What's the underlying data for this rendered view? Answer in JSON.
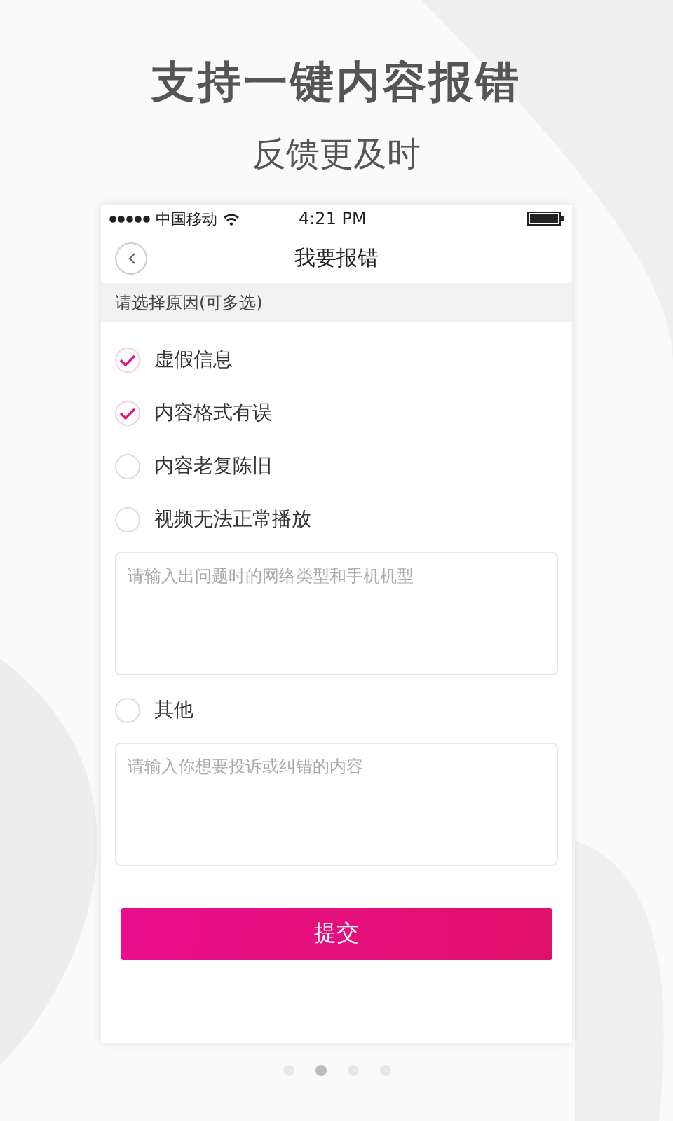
{
  "headline": "支持一键内容报错",
  "subheadline": "反馈更及时",
  "status_bar": {
    "carrier": "中国移动",
    "time": "4:21 PM"
  },
  "nav": {
    "title": "我要报错"
  },
  "section_header": "请选择原因(可多选)",
  "items": [
    {
      "kind": "checkbox",
      "label": "虚假信息",
      "checked": true
    },
    {
      "kind": "checkbox",
      "label": "内容格式有误",
      "checked": true
    },
    {
      "kind": "checkbox",
      "label": "内容老复陈旧",
      "checked": false
    },
    {
      "kind": "checkbox",
      "label": "视频无法正常播放",
      "checked": false
    },
    {
      "kind": "textarea",
      "placeholder": "请输入出问题时的网络类型和手机机型"
    },
    {
      "kind": "checkbox",
      "label": "其他",
      "checked": false
    },
    {
      "kind": "textarea",
      "placeholder": "请输入你想要投诉或纠错的内容"
    }
  ],
  "submit": "提交",
  "page_dots": [
    {
      "selected": false
    },
    {
      "selected": true
    },
    {
      "selected": false
    },
    {
      "selected": false
    }
  ]
}
